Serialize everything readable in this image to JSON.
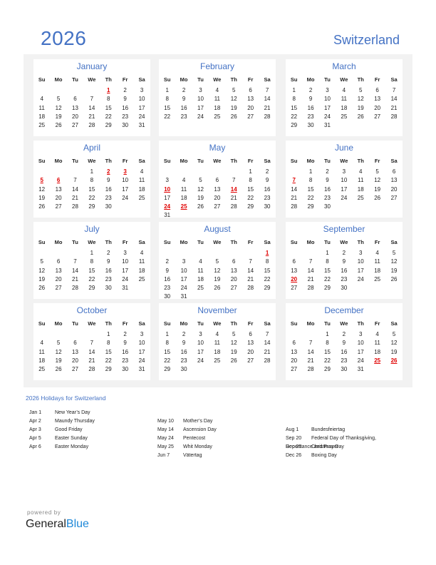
{
  "header": {
    "year": "2026",
    "country": "Switzerland"
  },
  "weekday_labels": [
    "Su",
    "Mo",
    "Tu",
    "We",
    "Th",
    "Fr",
    "Sa"
  ],
  "colors": {
    "accent": "#4472c4",
    "holiday": "#e00000",
    "panel": "#f2f2f2",
    "brand_blue": "#1e88d8"
  },
  "months": [
    {
      "name": "January",
      "start": 4,
      "days": 31,
      "holidays": [
        1
      ]
    },
    {
      "name": "February",
      "start": 0,
      "days": 28,
      "holidays": []
    },
    {
      "name": "March",
      "start": 0,
      "days": 31,
      "holidays": []
    },
    {
      "name": "April",
      "start": 3,
      "days": 30,
      "holidays": [
        2,
        3,
        5,
        6
      ]
    },
    {
      "name": "May",
      "start": 5,
      "days": 31,
      "holidays": [
        10,
        14,
        24,
        25
      ]
    },
    {
      "name": "June",
      "start": 1,
      "days": 30,
      "holidays": [
        7
      ]
    },
    {
      "name": "July",
      "start": 3,
      "days": 31,
      "holidays": []
    },
    {
      "name": "August",
      "start": 6,
      "days": 31,
      "holidays": [
        1
      ]
    },
    {
      "name": "September",
      "start": 2,
      "days": 30,
      "holidays": [
        20
      ]
    },
    {
      "name": "October",
      "start": 4,
      "days": 31,
      "holidays": []
    },
    {
      "name": "November",
      "start": 0,
      "days": 30,
      "holidays": []
    },
    {
      "name": "December",
      "start": 2,
      "days": 31,
      "holidays": [
        25,
        26
      ]
    }
  ],
  "holidays_section": {
    "title": "2026 Holidays for Switzerland",
    "columns": [
      [
        {
          "date": "Jan 1",
          "name": "New Year’s Day"
        },
        {
          "date": "Apr 2",
          "name": "Maundy Thursday"
        },
        {
          "date": "Apr 3",
          "name": "Good Friday"
        },
        {
          "date": "Apr 5",
          "name": "Easter Sunday"
        },
        {
          "date": "Apr 6",
          "name": "Easter Monday"
        }
      ],
      [
        {
          "date": "May 10",
          "name": "Mother’s Day"
        },
        {
          "date": "May 14",
          "name": "Ascension Day"
        },
        {
          "date": "May 24",
          "name": "Pentecost"
        },
        {
          "date": "May 25",
          "name": "Whit Monday"
        },
        {
          "date": "Jun 7",
          "name": "Vätertag"
        }
      ],
      [
        {
          "date": "Aug 1",
          "name": "Bundesfeiertag"
        },
        {
          "date": "Sep 20",
          "name": "Federal Day of Thanksgiving, Repentance and Prayer"
        },
        {
          "date": "Dec 25",
          "name": "Christmas Day"
        },
        {
          "date": "Dec 26",
          "name": "Boxing Day"
        }
      ]
    ]
  },
  "footer": {
    "powered_by": "powered by",
    "brand_general": "General",
    "brand_blue": "Blue"
  }
}
